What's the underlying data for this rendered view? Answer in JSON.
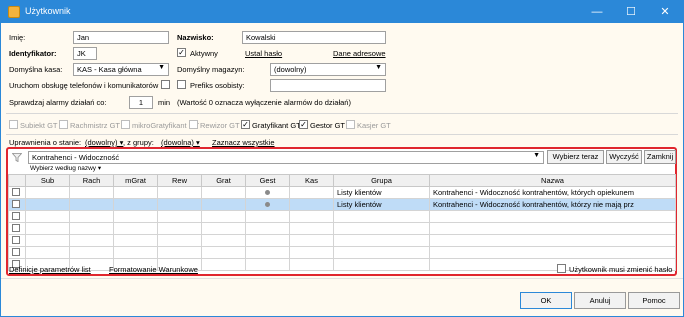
{
  "window": {
    "title": "Użytkownik",
    "minimize": "—",
    "maximize": "☐",
    "close": "✕"
  },
  "form": {
    "imie_label": "Imię:",
    "imie_value": "Jan",
    "nazwisko_label": "Nazwisko:",
    "nazwisko_value": "Kowalski",
    "identyfikator_label": "Identyfikator:",
    "identyfikator_value": "JK",
    "aktywny_label": "Aktywny",
    "aktywny_checked": true,
    "ustal_haslo": "Ustal hasło",
    "dane_adresowe": "Dane adresowe",
    "kasa_label": "Domyślna kasa:",
    "kasa_value": "KAS - Kasa główna",
    "magazyn_label": "Domyślny magazyn:",
    "magazyn_value": "(dowolny)",
    "telefon_label": "Uruchom obsługę telefonów i komunikatorów",
    "prefiks_label": "Prefiks osobisty:",
    "alarmy_label": "Sprawdzaj alarmy działań co:",
    "alarmy_value": "1",
    "alarmy_unit": "min",
    "alarmy_note": "(Wartość 0 oznacza wyłączenie alarmów do działań)"
  },
  "roles": [
    {
      "label": "Subiekt GT",
      "checked": false,
      "enabled": false
    },
    {
      "label": "Rachmistrz GT",
      "checked": false,
      "enabled": false
    },
    {
      "label": "mikroGratyfikant GT",
      "checked": false,
      "enabled": false
    },
    {
      "label": "Rewizor GT",
      "checked": false,
      "enabled": false
    },
    {
      "label": "Gratyfikant GT",
      "checked": true,
      "enabled": true
    },
    {
      "label": "Gestor GT",
      "checked": true,
      "enabled": true
    },
    {
      "label": "Kasjer GT",
      "checked": false,
      "enabled": false
    }
  ],
  "permissions": {
    "stan_label": "Uprawnienia o stanie:",
    "stan_value": "(dowolny) ▾",
    "grupa_label": ", z grupy:",
    "grupa_value": "(dowolna) ▾",
    "zaznacz_wszystkie": "Zaznacz wszystkie",
    "filter_value": "Kontrahenci - Widoczność",
    "wybierz_teraz": "Wybierz teraz",
    "wyczysc": "Wyczyść",
    "zamknij": "Zamknij",
    "wybierz_wedlug": "Wybierz według nazwy ▾"
  },
  "table": {
    "columns": [
      "",
      "Sub",
      "Rach",
      "mGrat",
      "Rew",
      "Grat",
      "Gest",
      "Kas",
      "Grupa",
      "Nazwa"
    ],
    "rows": [
      {
        "gest": "●",
        "grupa": "Listy klientów",
        "nazwa": "Kontrahenci - Widoczność kontrahentów, których opiekunem",
        "selected": false
      },
      {
        "gest": "●",
        "grupa": "Listy klientów",
        "nazwa": "Kontrahenci - Widoczność kontrahentów, którzy nie mają prz",
        "selected": true
      },
      {
        "gest": "",
        "grupa": "",
        "nazwa": "",
        "selected": false
      },
      {
        "gest": "",
        "grupa": "",
        "nazwa": "",
        "selected": false
      },
      {
        "gest": "",
        "grupa": "",
        "nazwa": "",
        "selected": false
      },
      {
        "gest": "",
        "grupa": "",
        "nazwa": "",
        "selected": false
      },
      {
        "gest": "",
        "grupa": "",
        "nazwa": "",
        "selected": false
      }
    ]
  },
  "footer": {
    "definicje": "Definicje parametrów list",
    "formatowanie": "Formatowanie Warunkowe",
    "zmienic_haslo": "Użytkownik musi zmienić hasło",
    "ok": "OK",
    "anuluj": "Anuluj",
    "pomoc": "Pomoc"
  }
}
